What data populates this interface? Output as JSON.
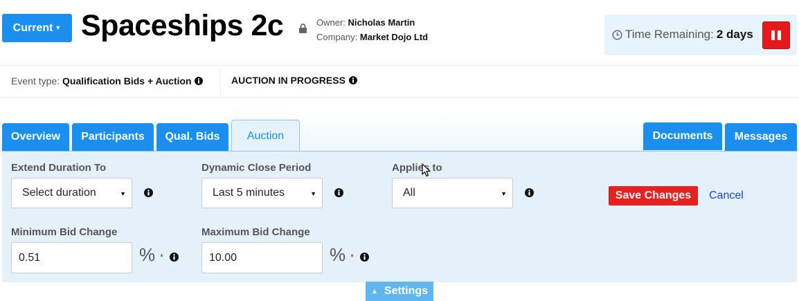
{
  "header": {
    "current_label": "Current",
    "title": "Spaceships 2c",
    "owner_label": "Owner:",
    "owner_value": "Nicholas Martin",
    "company_label": "Company:",
    "company_value": "Market Dojo Ltd",
    "time_label": "Time Remaining:",
    "time_value": "2 days"
  },
  "info": {
    "event_type_label": "Event type:",
    "event_type_value": "Qualification Bids + Auction",
    "status": "AUCTION IN PROGRESS"
  },
  "tabs": {
    "overview": "Overview",
    "participants": "Participants",
    "qual_bids": "Qual. Bids",
    "auction": "Auction",
    "documents": "Documents",
    "messages": "Messages",
    "active": "Auction"
  },
  "form": {
    "extend_duration_label": "Extend Duration To",
    "extend_duration_value": "Select duration",
    "dynamic_close_label": "Dynamic Close Period",
    "dynamic_close_value": "Last 5 minutes",
    "applies_to_label": "Applies to",
    "applies_to_value": "All",
    "min_bid_label": "Minimum Bid Change",
    "min_bid_value": "0.51",
    "max_bid_label": "Maximum Bid Change",
    "max_bid_value": "10.00",
    "percent_symbol": "%",
    "required_mark": "*",
    "save_label": "Save Changes",
    "cancel_label": "Cancel"
  },
  "footer": {
    "settings_label": "Settings"
  },
  "colors": {
    "primary": "#1a8ff0",
    "danger": "#e5201e",
    "panel": "#e4f1fb"
  }
}
